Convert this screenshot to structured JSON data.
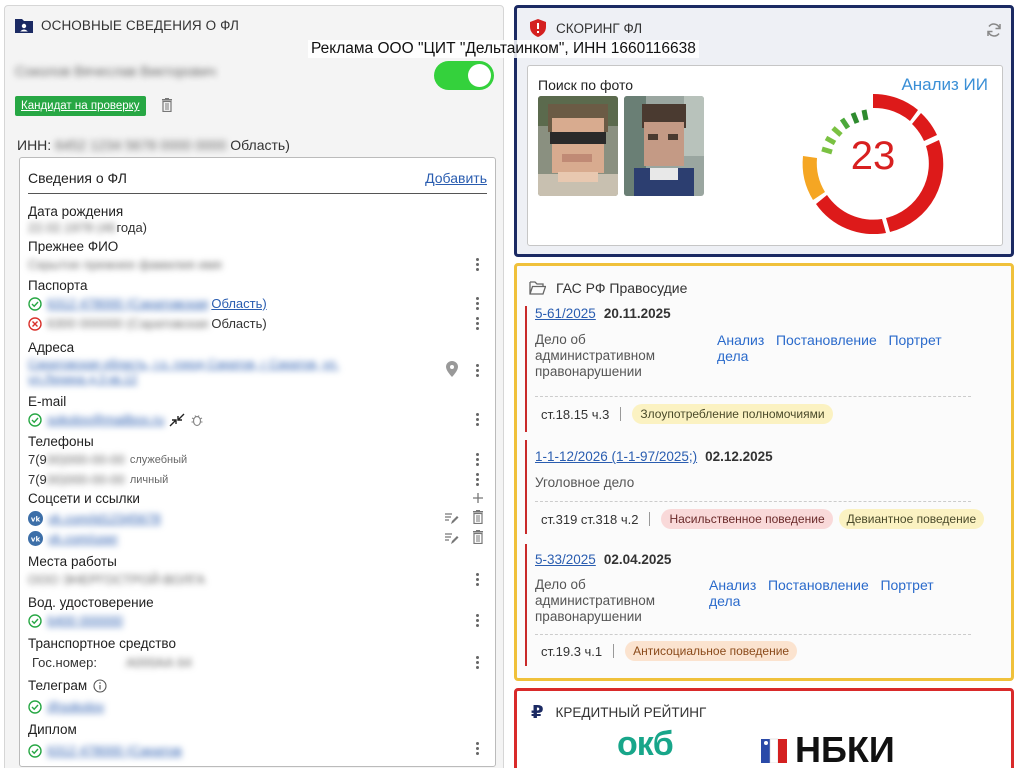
{
  "left": {
    "header": "ОСНОВНЫЕ СВЕДЕНИЯ О ФЛ",
    "full_name": "Соколов Вячеслав Викторович",
    "candidate_button": "Кандидат на проверку",
    "inn_label": "ИНН:",
    "inn_value": "6452 1234 5678 0000 0000",
    "inn_suffix": "Область)",
    "card": {
      "title": "Сведения о ФЛ",
      "add_link": "Добавить",
      "birth_label": "Дата рождения",
      "birth_value": "22.02.1978 (46",
      "birth_suffix": "года)",
      "prev_name_label": "Прежнее ФИО",
      "prev_name_value": "Скрытое прежнее фамилия имя",
      "passports_label": "Паспорта",
      "passport1_value": "6312 478000 (Саратовская",
      "passport1_suffix": "Область)",
      "passport2_value": "6300 000000 (Саратовская",
      "passport2_suffix": "Область)",
      "addresses_label": "Адреса",
      "address1": "Саратовская область, г.о. город Саратов, г Саратов, ул.",
      "address2": "ул.Ленина д.3 кв.12",
      "email_label": "E-mail",
      "email_value": "sokolov@mailbox.ru",
      "phones_label": "Телефоны",
      "phone1_prefix": "7(9",
      "phone1_hidden": "00)000-00-00",
      "phone1_type": "служебный",
      "phone2_prefix": "7(9",
      "phone2_hidden": "00)000-00-00",
      "phone2_type": "личный",
      "social_label": "Соцсети и ссылки",
      "social1": "vk.com/id12345678",
      "social2": "vk.com/user",
      "work_label": "Места работы",
      "work_value": "ООО ЭНЕРГОСТРОЙ-ВОЛГА",
      "driver_label": "Вод. удостоверение",
      "driver_value": "6400 000000",
      "vehicle_label": "Транспортное средство",
      "plate_label": "Гос.номер:",
      "plate_value": "А000АА 64",
      "telegram_label": "Телеграм",
      "telegram_value": "@sokolov",
      "diploma_label": "Диплом",
      "diploma_value": "6312 478000 (Саратов"
    }
  },
  "ad_banner": "Реклама ООО \"ЦИТ \"Дельтаинком\", ИНН 1660116638",
  "scoring": {
    "header": "СКОРИНГ ФЛ",
    "photo_search": "Поиск по фото",
    "ai_link": "Анализ ИИ",
    "score": "23",
    "colors": {
      "red": "#dd1a1a",
      "orange": "#f5a623",
      "green_dark": "#2e8b2e",
      "green_light": "#7ac142"
    }
  },
  "court": {
    "header": "ГАС РФ Правосудие",
    "cases": [
      {
        "number": "5-61/2025",
        "date": "20.11.2025",
        "type_lines": [
          "Дело об",
          "административном",
          "правонарушении"
        ],
        "actions": [
          "Анализ",
          "Постановление",
          "Портрет",
          "дела"
        ],
        "articles": "ст.18.15 ч.3",
        "tags": [
          "Злоупотребление полномочиями"
        ]
      },
      {
        "number": "1-1-12/2026 (1-1-97/2025;)",
        "date": "02.12.2025",
        "type_lines": [
          "Уголовное дело"
        ],
        "articles": "ст.319  ст.318 ч.2",
        "tags": [
          "Насильственное поведение",
          "Девиантное поведение"
        ]
      },
      {
        "number": "5-33/2025",
        "date": "02.04.2025",
        "type_lines": [
          "Дело об",
          "административном",
          "правонарушении"
        ],
        "actions": [
          "Анализ",
          "Постановление",
          "Портрет",
          "дела"
        ],
        "articles": "ст.19.3 ч.1",
        "tags": [
          "Антисоциальное поведение"
        ]
      }
    ]
  },
  "credit": {
    "header": "КРЕДИТНЫЙ РЕЙТИНГ",
    "okb": "окб",
    "nbki": "НБКИ"
  }
}
